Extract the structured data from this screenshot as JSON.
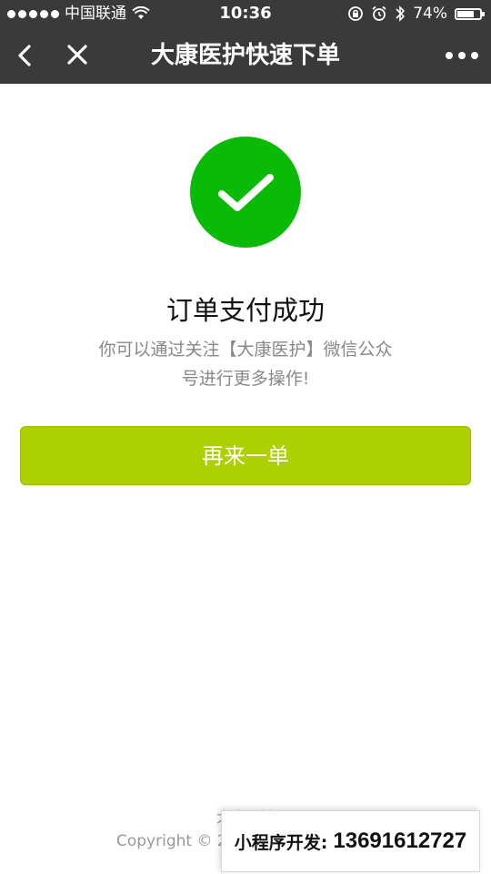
{
  "status_bar": {
    "carrier": "中国联通",
    "time": "10:36",
    "battery_percent": "74%",
    "battery_level": 0.74,
    "icons": [
      "signal-dots-icon",
      "wifi-icon",
      "rotation-lock-icon",
      "alarm-icon",
      "bluetooth-icon",
      "battery-icon"
    ]
  },
  "nav": {
    "title": "大康医护快速下单",
    "back_icon": "chevron-left-icon",
    "close_icon": "close-icon",
    "more_icon": "more-dots-icon"
  },
  "result": {
    "icon": "checkmark-circle-icon",
    "icon_color": "#09bb07",
    "title": "订单支付成功",
    "description": "你可以通过关注【大康医护】微信公众号进行更多操作!"
  },
  "actions": {
    "again_label": "再来一单",
    "again_color": "#acd000"
  },
  "footer": {
    "brand": "大康医护",
    "copyright": "Copyright © 2"
  },
  "dev_banner": {
    "label": "小程序开发:",
    "phone": "13691612727"
  }
}
